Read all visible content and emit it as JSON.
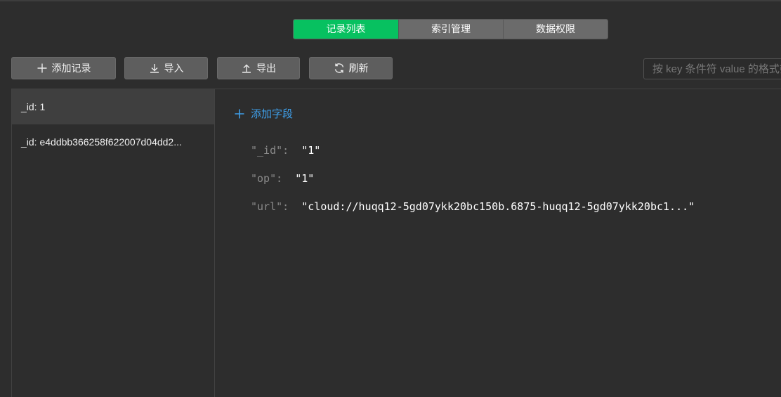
{
  "tabs": [
    {
      "label": "记录列表",
      "active": true
    },
    {
      "label": "索引管理",
      "active": false
    },
    {
      "label": "数据权限",
      "active": false
    }
  ],
  "toolbar": {
    "add_label": "添加记录",
    "import_label": "导入",
    "export_label": "导出",
    "refresh_label": "刷新"
  },
  "search": {
    "placeholder": "按 key 条件符 value 的格式筛选"
  },
  "records": [
    {
      "label": "_id: 1",
      "selected": true
    },
    {
      "label": "_id: e4ddbb366258f622007d04dd2...",
      "selected": false
    }
  ],
  "detail": {
    "add_field_label": "添加字段",
    "fields": [
      {
        "key": "\"_id\"",
        "colon": ":",
        "value": "\"1\""
      },
      {
        "key": "\"op\"",
        "colon": ":",
        "value": "\"1\""
      },
      {
        "key": "\"url\"",
        "colon": ":",
        "value": "\"cloud://huqq12-5gd07ykk20bc150b.6875-huqq12-5gd07ykk20bc1...\""
      }
    ]
  },
  "colors": {
    "accent_green": "#07c160",
    "link_blue": "#3e9ee8",
    "background": "#2d2d2d"
  }
}
